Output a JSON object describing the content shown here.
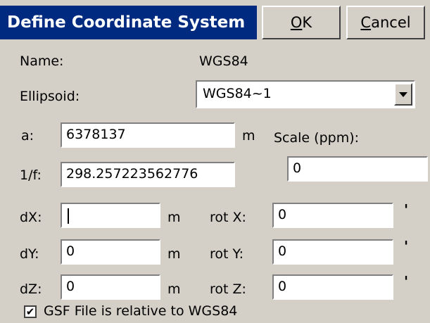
{
  "dialog": {
    "title": "Define Coordinate System",
    "ok_label": "OK",
    "ok_accel": "O",
    "ok_rest": "K",
    "cancel_label": "Cancel",
    "cancel_accel": "C",
    "cancel_rest": "ancel"
  },
  "name": {
    "label": "Name:",
    "value": "WGS84"
  },
  "ellipsoid": {
    "label": "Ellipsoid:",
    "selected": "WGS84~1"
  },
  "a": {
    "label": "a:",
    "value": "6378137",
    "unit": "m"
  },
  "inv_f": {
    "label": "1/f:",
    "value": "298.257223562776"
  },
  "scale": {
    "label": "Scale (ppm):",
    "value": "0"
  },
  "shifts": [
    {
      "label": "dX:",
      "value": "",
      "unit": "m",
      "rot_label": "rot X:",
      "rot_value": "0",
      "rot_unit": "'"
    },
    {
      "label": "dY:",
      "value": "0",
      "unit": "m",
      "rot_label": "rot Y:",
      "rot_value": "0",
      "rot_unit": "'"
    },
    {
      "label": "dZ:",
      "value": "0",
      "unit": "m",
      "rot_label": "rot Z:",
      "rot_value": "0",
      "rot_unit": "'"
    }
  ],
  "gsf": {
    "checked": true,
    "check_mark": "✔",
    "label": "GSF File is relative to WGS84"
  }
}
